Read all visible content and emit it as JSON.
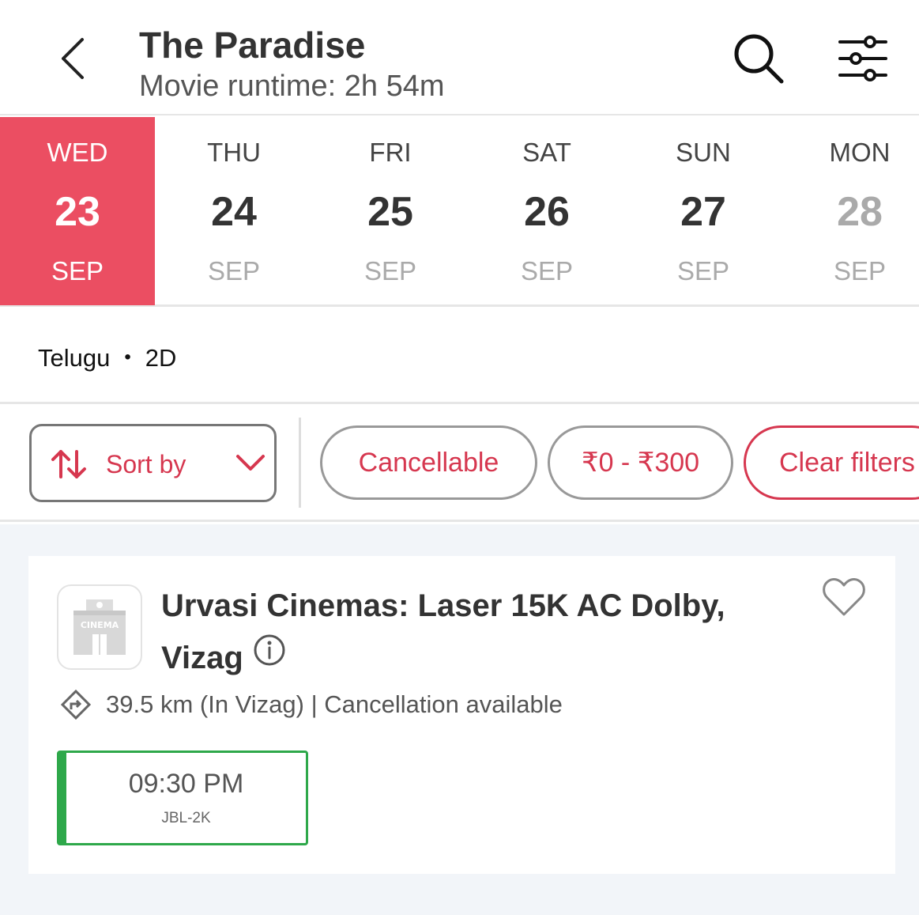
{
  "header": {
    "title": "The Paradise",
    "subtitle": "Movie runtime: 2h 54m"
  },
  "dates": [
    {
      "dow": "WED",
      "day": "23",
      "month": "SEP",
      "selected": true
    },
    {
      "dow": "THU",
      "day": "24",
      "month": "SEP"
    },
    {
      "dow": "FRI",
      "day": "25",
      "month": "SEP"
    },
    {
      "dow": "SAT",
      "day": "26",
      "month": "SEP"
    },
    {
      "dow": "SUN",
      "day": "27",
      "month": "SEP"
    },
    {
      "dow": "MON",
      "day": "28",
      "month": "SEP",
      "disabled": true
    }
  ],
  "format": {
    "language": "Telugu",
    "dimension": "2D"
  },
  "filters": {
    "sort_label": "Sort by",
    "chips": [
      "Cancellable",
      "₹0 - ₹300",
      "Clear filters"
    ]
  },
  "cinema": {
    "name_line1": "Urvasi Cinemas: Laser 15K AC Dolby,",
    "name_line2": "Vizag",
    "logo_text": "CINEMA",
    "meta": "39.5 km (In Vizag) | Cancellation available",
    "showtimes": [
      {
        "time": "09:30 PM",
        "format": "JBL-2K"
      }
    ]
  },
  "colors": {
    "accent": "#eb4e62",
    "accent_text": "#d6374f",
    "available": "#2ea84a"
  },
  "icons": {
    "back": "chevron-left-icon",
    "search": "search-icon",
    "filter": "sliders-icon",
    "sort": "sort-arrows-icon",
    "dropdown": "chevron-down-icon",
    "favorite": "heart-icon",
    "info": "info-icon",
    "directions": "directions-icon"
  }
}
